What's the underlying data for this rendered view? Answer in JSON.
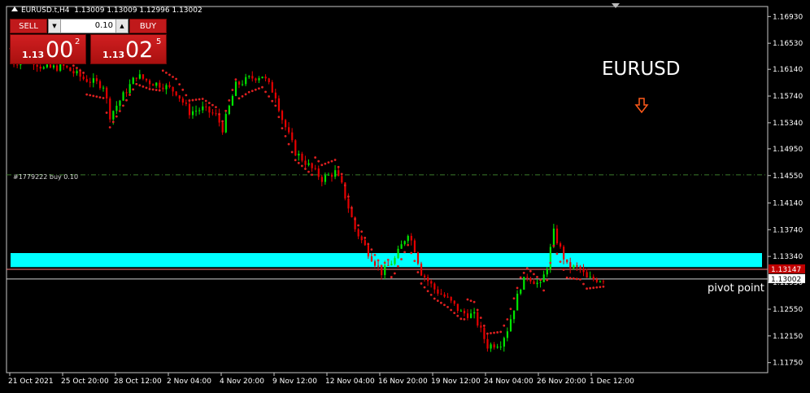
{
  "window": {
    "symbol": "EURUSD.t,H4",
    "ohlc": "1.13009 1.13009 1.12996 1.13002"
  },
  "trade_panel": {
    "sell_label": "SELL",
    "buy_label": "BUY",
    "lot": "0.10",
    "sell_price_prefix": "1.13",
    "sell_price_big": "00",
    "sell_price_sup": "2",
    "buy_price_prefix": "1.13",
    "buy_price_big": "02",
    "buy_price_sup": "5"
  },
  "annotations": {
    "symbol_title": "EURUSD",
    "pivot_label": "pivot point",
    "order_line_label": "#1779222 buy 0.10"
  },
  "colors": {
    "background": "#000000",
    "bull": "#00e600",
    "bear": "#e60000",
    "sar": "#e02020",
    "zone": "#00ffff",
    "order_line": "#3a7a2a",
    "price_tag": "#c00000",
    "arrow": "#ff5a1a"
  },
  "chart_data": {
    "type": "candlestick",
    "timeframe": "H4",
    "x_tick_labels": [
      "21 Oct 2021",
      "25 Oct 20:00",
      "28 Oct 12:00",
      "2 Nov 04:00",
      "4 Nov 20:00",
      "9 Nov 12:00",
      "12 Nov 04:00",
      "16 Nov 20:00",
      "19 Nov 12:00",
      "24 Nov 04:00",
      "26 Nov 20:00",
      "1 Dec 12:00"
    ],
    "y_tick_labels": [
      "1.16930",
      "1.16530",
      "1.16140",
      "1.15740",
      "1.15340",
      "1.14950",
      "1.14550",
      "1.14140",
      "1.13740",
      "1.13340",
      "1.12950",
      "1.12550",
      "1.12150",
      "1.11750"
    ],
    "ylim": [
      1.116,
      1.1708
    ],
    "order_line": {
      "price": 1.1456,
      "label": "#1779222 buy 0.10"
    },
    "support_zone": {
      "top": 1.1339,
      "bottom": 1.1318
    },
    "pivot_level": 1.13002,
    "current_price_tags": [
      "1.13147",
      "1.13002"
    ],
    "close_path": [
      [
        0,
        1.1623
      ],
      [
        6,
        1.163
      ],
      [
        10,
        1.1615
      ],
      [
        16,
        1.1618
      ],
      [
        22,
        1.16
      ],
      [
        28,
        1.159
      ],
      [
        30,
        1.1545
      ],
      [
        34,
        1.1575
      ],
      [
        38,
        1.1605
      ],
      [
        42,
        1.1595
      ],
      [
        46,
        1.159
      ],
      [
        50,
        1.158
      ],
      [
        54,
        1.155
      ],
      [
        58,
        1.1555
      ],
      [
        62,
        1.1545
      ],
      [
        64,
        1.1525
      ],
      [
        68,
        1.159
      ],
      [
        72,
        1.16
      ],
      [
        76,
        1.1605
      ],
      [
        80,
        1.1575
      ],
      [
        82,
        1.154
      ],
      [
        86,
        1.149
      ],
      [
        90,
        1.147
      ],
      [
        94,
        1.145
      ],
      [
        98,
        1.146
      ],
      [
        100,
        1.144
      ],
      [
        104,
        1.1375
      ],
      [
        108,
        1.134
      ],
      [
        112,
        1.131
      ],
      [
        116,
        1.133
      ],
      [
        120,
        1.137
      ],
      [
        122,
        1.1345
      ],
      [
        124,
        1.131
      ],
      [
        128,
        1.1285
      ],
      [
        132,
        1.127
      ],
      [
        136,
        1.125
      ],
      [
        140,
        1.1245
      ],
      [
        144,
        1.12
      ],
      [
        148,
        1.1205
      ],
      [
        150,
        1.1225
      ],
      [
        154,
        1.129
      ],
      [
        156,
        1.1305
      ],
      [
        160,
        1.129
      ],
      [
        162,
        1.132
      ],
      [
        164,
        1.137
      ],
      [
        168,
        1.132
      ],
      [
        172,
        1.1315
      ],
      [
        174,
        1.13
      ]
    ]
  }
}
